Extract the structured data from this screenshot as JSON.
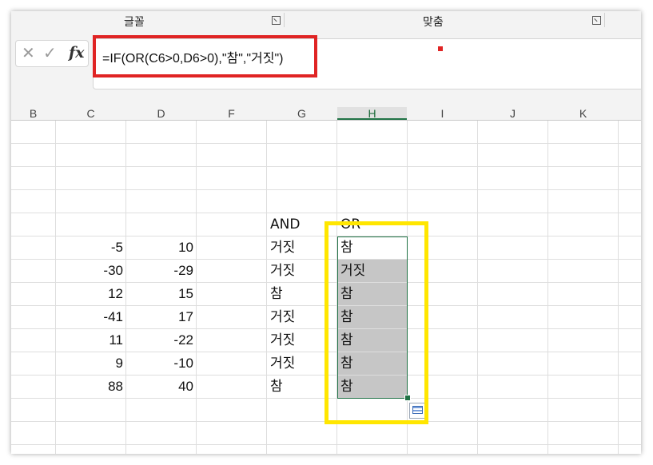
{
  "ribbon": {
    "groups": [
      {
        "label": "글꼴"
      },
      {
        "label": "맞춤"
      }
    ]
  },
  "formula_bar": {
    "cancel_glyph": "✕",
    "enter_glyph": "✓",
    "fx_label": "fx",
    "formula": "=IF(OR(C6>0,D6>0),\"참\",\"거짓\")"
  },
  "columns": [
    "B",
    "C",
    "D",
    "F",
    "G",
    "H",
    "I",
    "J",
    "K"
  ],
  "active_column": "H",
  "table": {
    "header_and": "AND",
    "header_or": "OR",
    "rows": [
      {
        "c": "-5",
        "d": "10",
        "g": "거짓",
        "h": "참"
      },
      {
        "c": "-30",
        "d": "-29",
        "g": "거짓",
        "h": "거짓"
      },
      {
        "c": "12",
        "d": "15",
        "g": "참",
        "h": "참"
      },
      {
        "c": "-41",
        "d": "17",
        "g": "거짓",
        "h": "참"
      },
      {
        "c": "11",
        "d": "-22",
        "g": "거짓",
        "h": "참"
      },
      {
        "c": "9",
        "d": "-10",
        "g": "거짓",
        "h": "참"
      },
      {
        "c": "88",
        "d": "40",
        "g": "참",
        "h": "참"
      }
    ]
  },
  "colors": {
    "highlight_red": "#e02424",
    "highlight_yellow": "#ffe600",
    "selection_green": "#217346",
    "selection_fill": "#c6c6c6"
  }
}
